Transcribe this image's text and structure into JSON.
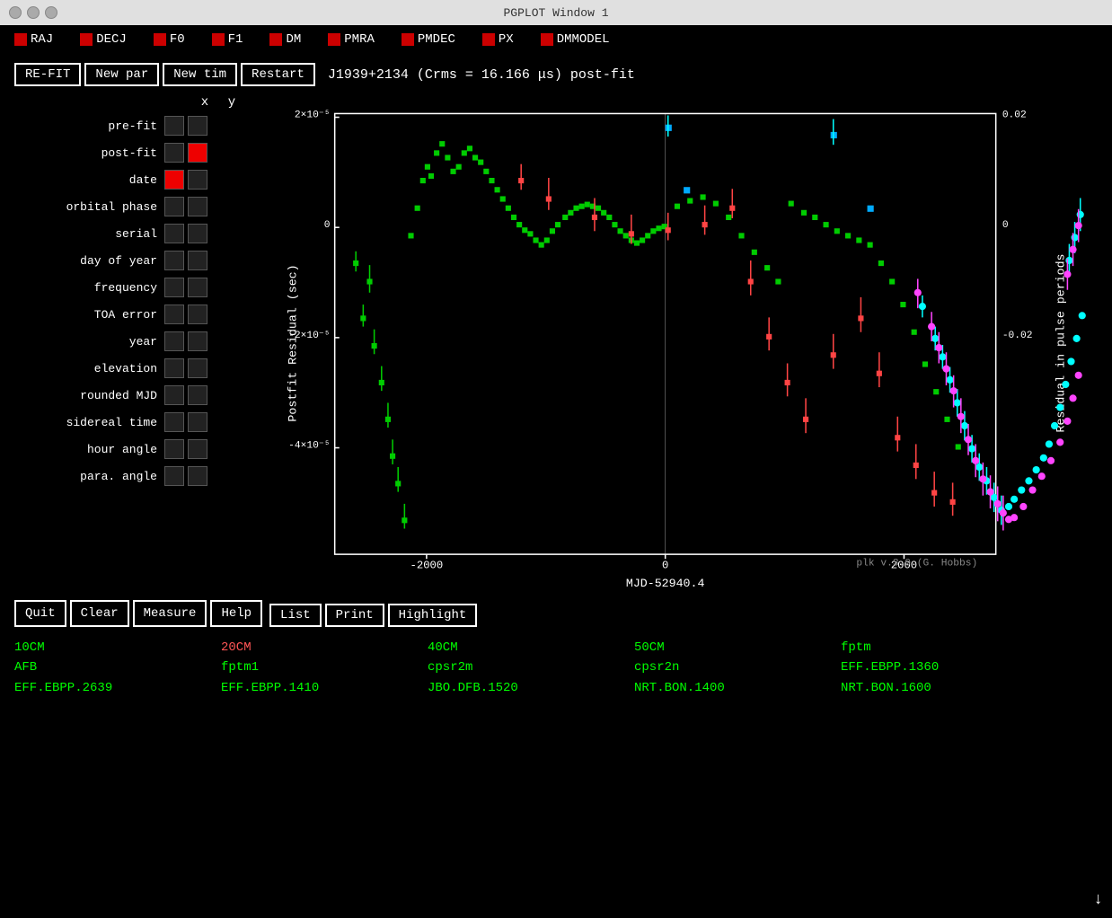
{
  "titlebar": {
    "title": "PGPLOT Window 1",
    "icon": "✕"
  },
  "params": [
    {
      "label": "RAJ",
      "checked": true
    },
    {
      "label": "DECJ",
      "checked": true
    },
    {
      "label": "F0",
      "checked": true
    },
    {
      "label": "F1",
      "checked": true
    },
    {
      "label": "DM",
      "checked": true
    },
    {
      "label": "PMRA",
      "checked": true
    },
    {
      "label": "PMDEC",
      "checked": true
    },
    {
      "label": "PX",
      "checked": true
    },
    {
      "label": "DMMODEL",
      "checked": true
    }
  ],
  "toolbar": {
    "refit": "RE-FIT",
    "new_par": "New par",
    "new_tim": "New tim",
    "restart": "Restart",
    "plot_title": "J1939+2134 (Crms = 16.166 μs) post-fit"
  },
  "axis_panel": {
    "x_label": "x",
    "y_label": "y",
    "rows": [
      {
        "label": "pre-fit",
        "x": false,
        "y": false
      },
      {
        "label": "post-fit",
        "x": false,
        "y": true
      },
      {
        "label": "date",
        "x": true,
        "y": false
      },
      {
        "label": "orbital phase",
        "x": false,
        "y": false
      },
      {
        "label": "serial",
        "x": false,
        "y": false
      },
      {
        "label": "day of year",
        "x": false,
        "y": false
      },
      {
        "label": "frequency",
        "x": false,
        "y": false
      },
      {
        "label": "TOA error",
        "x": false,
        "y": false
      },
      {
        "label": "year",
        "x": false,
        "y": false
      },
      {
        "label": "elevation",
        "x": false,
        "y": false
      },
      {
        "label": "rounded MJD",
        "x": false,
        "y": false
      },
      {
        "label": "sidereal time",
        "x": false,
        "y": false
      },
      {
        "label": "hour angle",
        "x": false,
        "y": false
      },
      {
        "label": "para. angle",
        "x": false,
        "y": false
      }
    ]
  },
  "plot": {
    "x_label": "MJD-52940.4",
    "y_label_left": "Postfit Residual (sec)",
    "y_label_right": "Residual in pulse periods",
    "x_ticks": [
      "-2000",
      "0",
      "2000"
    ],
    "y_ticks_left": [
      "-4×10⁻⁵",
      "-2×10⁻⁵",
      "0",
      "2×10⁻⁵"
    ],
    "y_ticks_right": [
      "-0.02",
      "0",
      "0.02"
    ],
    "version": "plk v.3.0 (G. Hobbs)"
  },
  "bottom_buttons": {
    "quit": "Quit",
    "clear": "Clear",
    "measure": "Measure",
    "help": "Help",
    "list": "List",
    "print": "Print",
    "highlight": "Highlight"
  },
  "legend": {
    "col1": [
      {
        "text": "10CM",
        "color": "green"
      },
      {
        "text": "AFB",
        "color": "green"
      },
      {
        "text": "EFF.EBPP.2639",
        "color": "green"
      }
    ],
    "col2": [
      {
        "text": "20CM",
        "color": "red"
      },
      {
        "text": "fptm1",
        "color": "green"
      },
      {
        "text": "EFF.EBPP.1410",
        "color": "green"
      }
    ],
    "col3": [
      {
        "text": "40CM",
        "color": "green"
      },
      {
        "text": "cpsr2m",
        "color": "green"
      },
      {
        "text": "JBO.DFB.1520",
        "color": "green"
      }
    ],
    "col4": [
      {
        "text": "50CM",
        "color": "green"
      },
      {
        "text": "cpsr2n",
        "color": "green"
      },
      {
        "text": "NRT.BON.1400",
        "color": "green"
      }
    ],
    "col5": [
      {
        "text": "fptm",
        "color": "green"
      },
      {
        "text": "EFF.EBPP.1360",
        "color": "green"
      },
      {
        "text": "NRT.BON.1600",
        "color": "green"
      }
    ]
  }
}
